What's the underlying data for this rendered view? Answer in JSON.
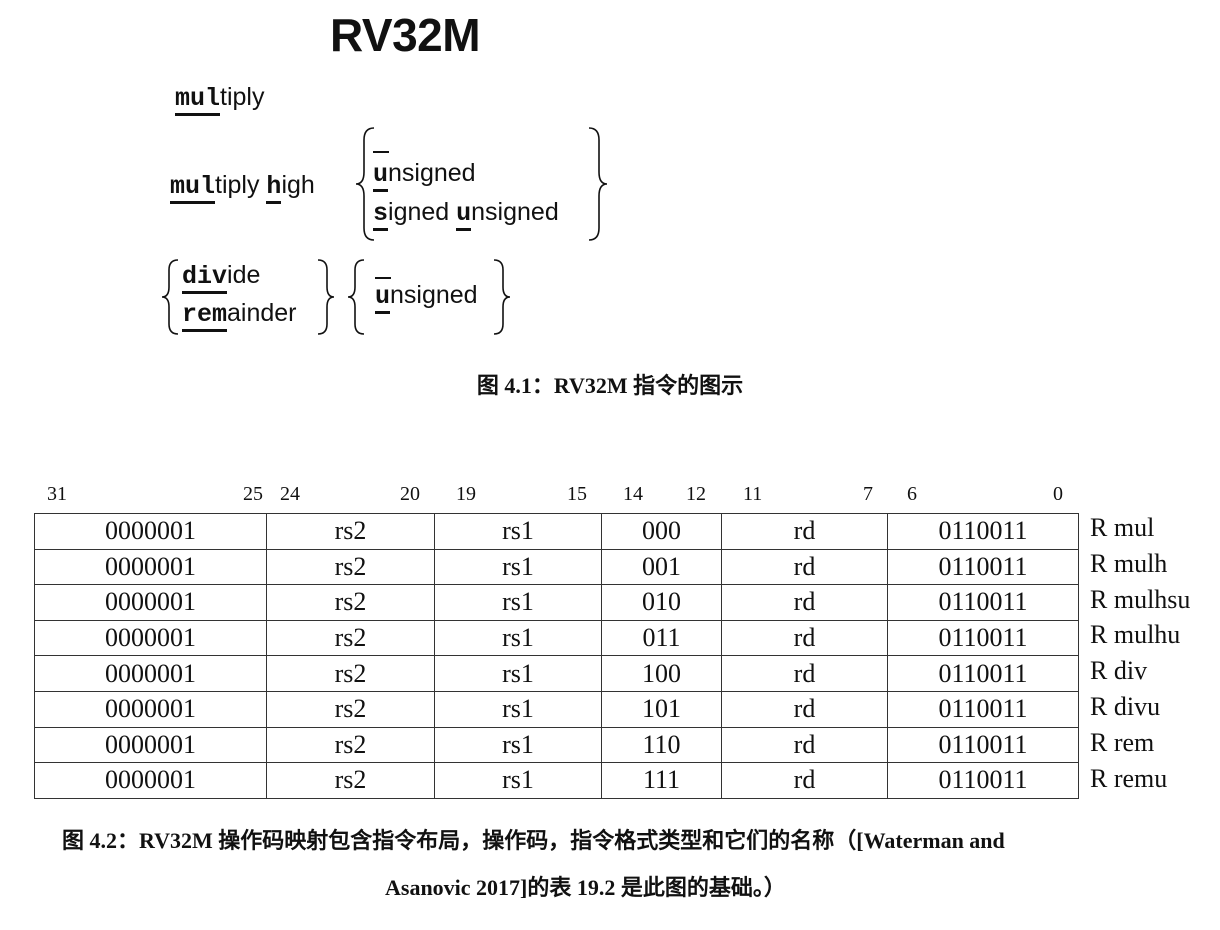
{
  "figure1": {
    "title": "RV32M",
    "line1": {
      "bold": "mul",
      "rest": "tiply"
    },
    "line2": {
      "bold1": "mul",
      "rest1": "tiply ",
      "bold2": "h",
      "rest2": "igh"
    },
    "opt_dash": "_",
    "opt_unsigned": {
      "bold": "u",
      "rest": "nsigned"
    },
    "opt_signed_unsigned": {
      "bold1": "s",
      "rest1": "igned ",
      "bold2": "u",
      "rest2": "nsigned"
    },
    "line3a": {
      "bold": "div",
      "rest": "ide"
    },
    "line3b": {
      "bold": "rem",
      "rest": "ainder"
    },
    "caption": "图 4.1：RV32M 指令的图示"
  },
  "bit_labels": [
    "31",
    "25",
    "24",
    "20",
    "19",
    "15",
    "14",
    "12",
    "11",
    "7",
    "6",
    "0"
  ],
  "table": {
    "rows": [
      {
        "funct7": "0000001",
        "rs2": "rs2",
        "rs1": "rs1",
        "funct3": "000",
        "rd": "rd",
        "opcode": "0110011",
        "name": "R mul"
      },
      {
        "funct7": "0000001",
        "rs2": "rs2",
        "rs1": "rs1",
        "funct3": "001",
        "rd": "rd",
        "opcode": "0110011",
        "name": "R mulh"
      },
      {
        "funct7": "0000001",
        "rs2": "rs2",
        "rs1": "rs1",
        "funct3": "010",
        "rd": "rd",
        "opcode": "0110011",
        "name": "R mulhsu"
      },
      {
        "funct7": "0000001",
        "rs2": "rs2",
        "rs1": "rs1",
        "funct3": "011",
        "rd": "rd",
        "opcode": "0110011",
        "name": "R mulhu"
      },
      {
        "funct7": "0000001",
        "rs2": "rs2",
        "rs1": "rs1",
        "funct3": "100",
        "rd": "rd",
        "opcode": "0110011",
        "name": "R div"
      },
      {
        "funct7": "0000001",
        "rs2": "rs2",
        "rs1": "rs1",
        "funct3": "101",
        "rd": "rd",
        "opcode": "0110011",
        "name": "R divu"
      },
      {
        "funct7": "0000001",
        "rs2": "rs2",
        "rs1": "rs1",
        "funct3": "110",
        "rd": "rd",
        "opcode": "0110011",
        "name": "R rem"
      },
      {
        "funct7": "0000001",
        "rs2": "rs2",
        "rs1": "rs1",
        "funct3": "111",
        "rd": "rd",
        "opcode": "0110011",
        "name": "R remu"
      }
    ]
  },
  "figure2": {
    "caption_line1": "图 4.2：RV32M 操作码映射包含指令布局，操作码，指令格式类型和它们的名称（[Waterman and",
    "caption_line2": "Asanovic 2017]的表 19.2 是此图的基础。）"
  }
}
